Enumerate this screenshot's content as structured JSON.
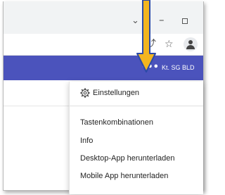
{
  "colors": {
    "brand": "#4b53bc",
    "arrow_fill": "#f2b51f",
    "arrow_outline": "#2b4aa8"
  },
  "browser": {
    "titlebar_buttons": {
      "chevron": "⌄",
      "minimize": "–"
    },
    "toolbar_icons": [
      "share-icon",
      "star-icon",
      "profile-avatar-icon"
    ],
    "star_glyph": "☆",
    "share_glyph": "⤴"
  },
  "header": {
    "more_glyph": "•••",
    "org_name": "Kt. SG BLD"
  },
  "menu": {
    "settings_label": "Einstellungen",
    "items": [
      "Tastenkombinationen",
      "Info",
      "Desktop-App herunterladen",
      "Mobile App herunterladen"
    ]
  }
}
